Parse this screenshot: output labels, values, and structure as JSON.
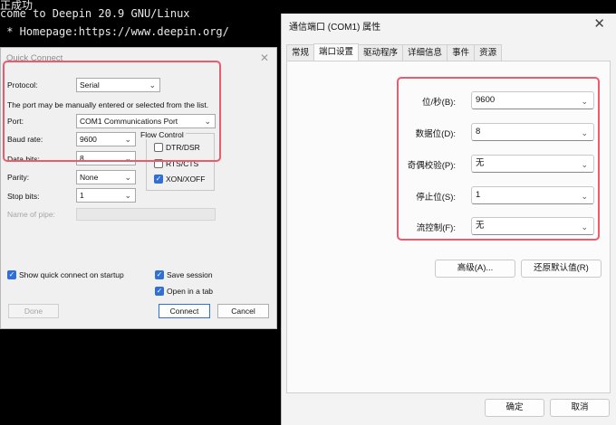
{
  "terminal": {
    "line0": "正成功",
    "line1": "come to Deepin 20.9 GNU/Linux",
    "line2": " * Homepage:https://www.deepin.org/"
  },
  "quick_connect": {
    "title": "Quick Connect",
    "protocol_label": "Protocol:",
    "protocol_value": "Serial",
    "hint": "The port may be manually entered or selected from the list.",
    "port_label": "Port:",
    "port_value": "COM1 Communications Port",
    "baud_label": "Baud rate:",
    "baud_value": "9600",
    "data_bits_label": "Data bits:",
    "data_bits_value": "8",
    "parity_label": "Parity:",
    "parity_value": "None",
    "stop_bits_label": "Stop bits:",
    "stop_bits_value": "1",
    "flow_control_label": "Flow Control",
    "dtr_dsr": "DTR/DSR",
    "rts_cts": "RTS/CTS",
    "xon_xoff": "XON/XOFF",
    "pipe_label": "Name of pipe:",
    "show_startup": "Show quick connect on startup",
    "save_session": "Save session",
    "open_in_tab": "Open in a tab",
    "done_label": "Done",
    "connect_label": "Connect",
    "cancel_label": "Cancel"
  },
  "port_props": {
    "title": "通信端口 (COM1) 属性",
    "tabs": [
      {
        "label": "常规"
      },
      {
        "label": "端口设置"
      },
      {
        "label": "驱动程序"
      },
      {
        "label": "详细信息"
      },
      {
        "label": "事件"
      },
      {
        "label": "资源"
      }
    ],
    "bits_label": "位/秒(B):",
    "bits_value": "9600",
    "data_label": "数据位(D):",
    "data_value": "8",
    "parity_label": "奇偶校验(P):",
    "parity_value": "无",
    "stop_label": "停止位(S):",
    "stop_value": "1",
    "flow_label": "流控制(F):",
    "flow_value": "无",
    "advanced_label": "高级(A)...",
    "restore_label": "还原默认值(R)",
    "ok_label": "确定",
    "cancel_label": "取消"
  },
  "colors": {
    "highlight": "#ec5a6d",
    "accent": "#2f6fd6"
  }
}
